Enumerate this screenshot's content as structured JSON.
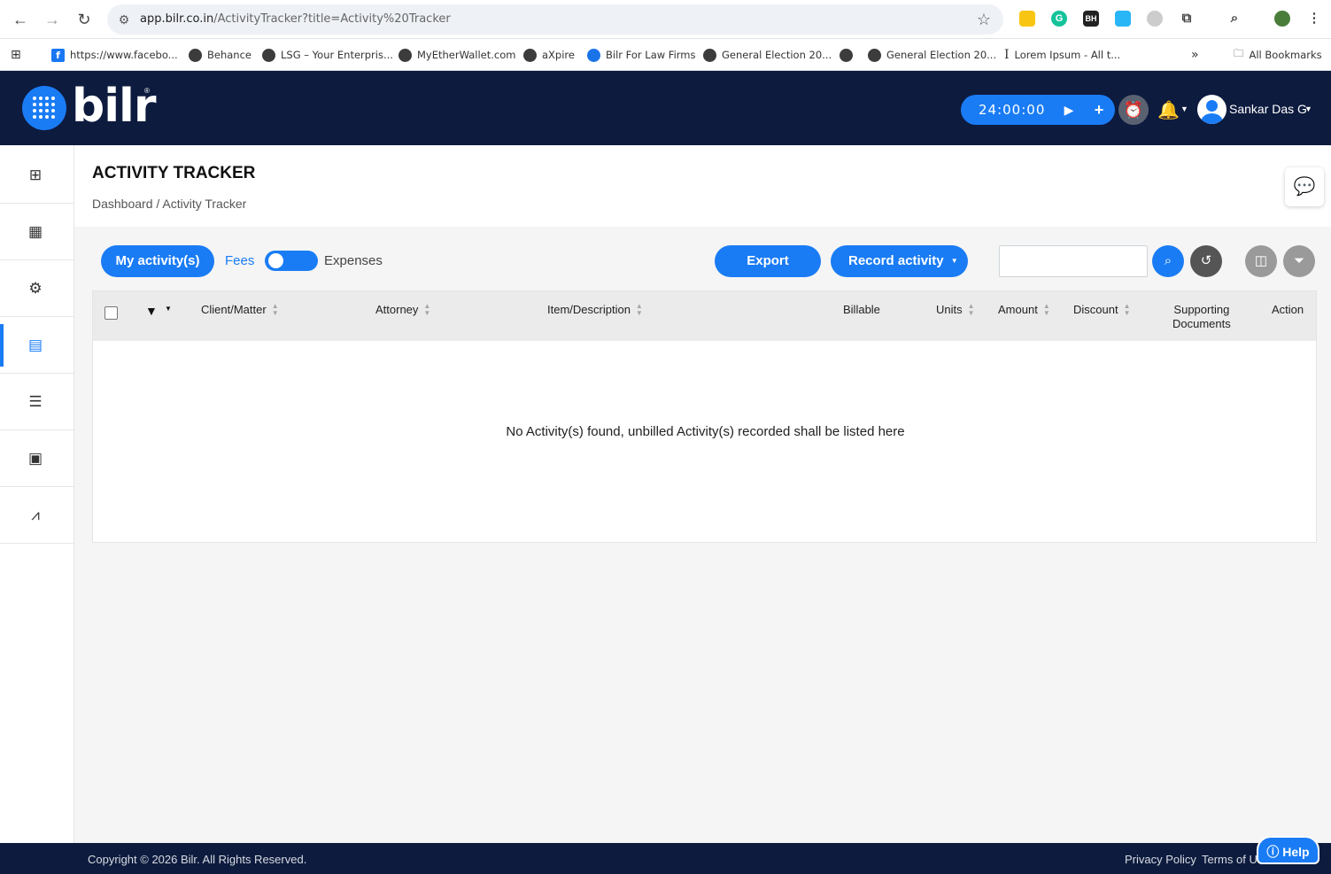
{
  "browser": {
    "url_host": "app.bilr.co.in",
    "url_path": "/ActivityTracker?title=Activity%20Tracker",
    "bookmarks": [
      {
        "label": "https://www.facebo...",
        "icon": "facebook-icon"
      },
      {
        "label": "Behance",
        "icon": "globe-icon"
      },
      {
        "label": "LSG – Your Enterpris...",
        "icon": "globe-icon"
      },
      {
        "label": "MyEtherWallet.com",
        "icon": "globe-icon"
      },
      {
        "label": "aXpire",
        "icon": "globe-icon"
      },
      {
        "label": "Bilr For Law Firms",
        "icon": "bilr-icon"
      },
      {
        "label": "General Election 20...",
        "icon": "globe-icon"
      },
      {
        "label": "",
        "icon": "globe-icon"
      },
      {
        "label": "General Election 20...",
        "icon": "globe-icon"
      },
      {
        "label": "Lorem Ipsum - All t...",
        "icon": "lorem-icon"
      }
    ],
    "overflow": "»",
    "all_bookmarks": "All Bookmarks"
  },
  "header": {
    "logo_text": "bilr",
    "logo_reg": "®",
    "timer": "24:00:00",
    "user_name": "Sankar Das G"
  },
  "page": {
    "title": "ACTIVITY TRACKER",
    "breadcrumb": "Dashboard / Activity Tracker"
  },
  "toolbar": {
    "my_activities": "My activity(s)",
    "fees": "Fees",
    "expenses": "Expenses",
    "export": "Export",
    "record_activity": "Record activity",
    "search_placeholder": ""
  },
  "table": {
    "columns": {
      "client_matter": "Client/Matter",
      "attorney": "Attorney",
      "item_description": "Item/Description",
      "billable": "Billable",
      "units": "Units",
      "amount": "Amount",
      "discount": "Discount",
      "supporting_1": "Supporting",
      "supporting_2": "Documents",
      "action": "Action"
    },
    "empty_message": "No Activity(s) found, unbilled Activity(s) recorded shall be listed here"
  },
  "footer": {
    "copyright": "Copyright © 2026 Bilr. All Rights Reserved.",
    "privacy": "Privacy Policy",
    "terms": "Terms of Use",
    "help": "Help"
  },
  "colors": {
    "brand_blue": "#1a7cf5",
    "navy": "#0d1b3e"
  }
}
